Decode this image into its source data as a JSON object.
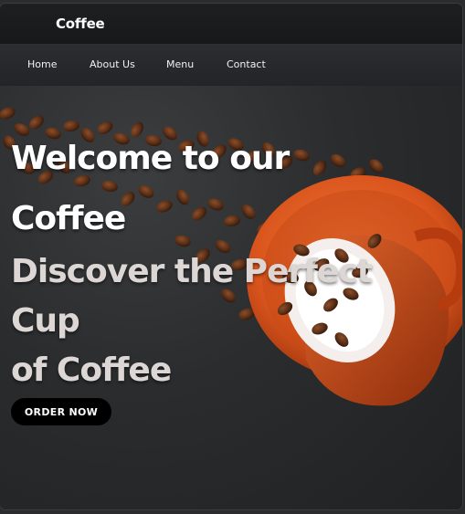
{
  "header": {
    "brand": "Coffee"
  },
  "nav": {
    "items": [
      "Home",
      "About Us",
      "Menu",
      "Contact"
    ]
  },
  "hero": {
    "title_line1": "Welcome to our",
    "title_line2": "Coffee",
    "subtitle_line1": "Discover the Perfect",
    "subtitle_line2": "Cup",
    "subtitle_line3": "of Coffee",
    "cta_label": "ORDER NOW"
  },
  "colors": {
    "background": "#1b1d1f",
    "cup_orange": "#d9541c",
    "button": "#000000",
    "title_text": "#ffffff",
    "subtitle_text": "#dcd6d4"
  }
}
